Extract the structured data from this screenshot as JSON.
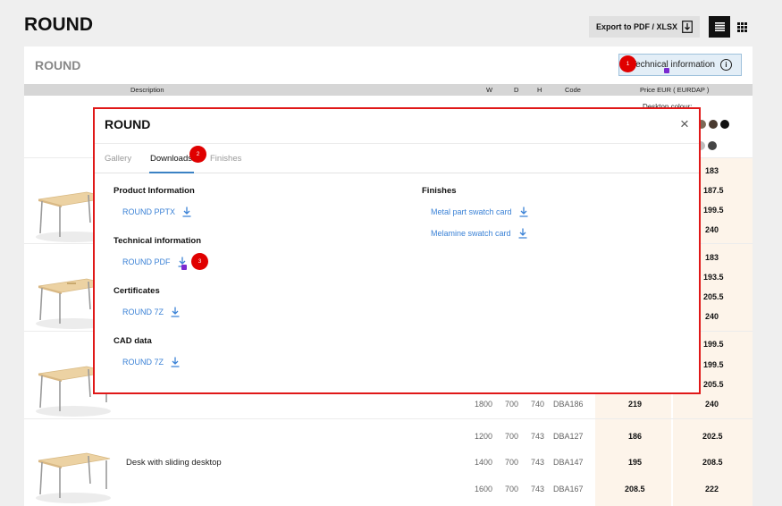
{
  "header": {
    "title": "ROUND",
    "export_label": "Export to PDF / XLSX"
  },
  "card": {
    "title": "ROUND",
    "tech_info_label": "Technical information",
    "columns": {
      "description": "Description",
      "w": "W",
      "d": "D",
      "h": "H",
      "code": "Code",
      "price": "Price EUR ( EURDAP )"
    },
    "finish_label": "Desktop colour:",
    "row_1800": {
      "w": "1800",
      "d": "700",
      "h": "740",
      "code": "DBA186",
      "p1": "219",
      "p2": "240"
    },
    "sliding": {
      "description": "Desk with sliding desktop",
      "rows": [
        {
          "w": "1200",
          "d": "700",
          "h": "743",
          "code": "DBA127",
          "p1": "186",
          "p2": "202.5"
        },
        {
          "w": "1400",
          "d": "700",
          "h": "743",
          "code": "DBA147",
          "p1": "195",
          "p2": "208.5"
        },
        {
          "w": "1600",
          "d": "700",
          "h": "743",
          "code": "DBA167",
          "p1": "208.5",
          "p2": "222"
        }
      ]
    },
    "hidden_prices": [
      "183",
      "187.5",
      "199.5",
      "240",
      "183",
      "193.5",
      "205.5",
      "240",
      "199.5",
      "199.5",
      "205.5"
    ]
  },
  "modal": {
    "title": "ROUND",
    "tabs": [
      "Gallery",
      "Downloads",
      "Finishes"
    ],
    "sections": {
      "product": {
        "title": "Product Information",
        "link": "ROUND PPTX"
      },
      "technical": {
        "title": "Technical information",
        "link": "ROUND PDF"
      },
      "certificates": {
        "title": "Certificates",
        "link": "ROUND 7Z"
      },
      "cad": {
        "title": "CAD data",
        "link": "ROUND 7Z"
      },
      "finishes": {
        "title": "Finishes",
        "links": [
          "Metal part swatch card",
          "Melamine swatch card"
        ]
      }
    }
  },
  "markers": [
    "1",
    "2",
    "3"
  ],
  "colors": {
    "accent": "#3b82d6",
    "modal_border": "#e01818",
    "marker": "#e00000",
    "price_bg": "#fdf4ea",
    "swatches_row1": [
      "#d9c9a8",
      "#7a6a58",
      "#4a3a30",
      "#111111"
    ],
    "swatches_row2": [
      "#bdbdbd",
      "#444444"
    ]
  },
  "icons": [
    "download-icon",
    "info-icon",
    "close-icon",
    "list-view-icon",
    "grid-view-icon"
  ]
}
